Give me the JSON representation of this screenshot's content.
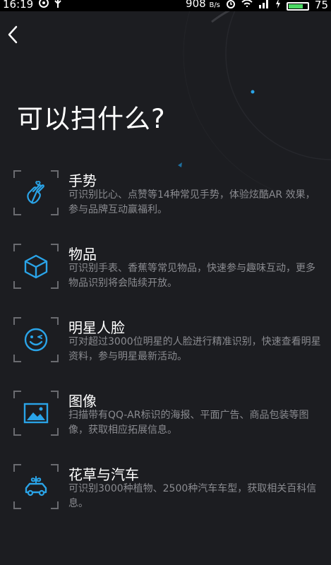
{
  "status_bar": {
    "time": "16:19",
    "network_speed": "908",
    "network_speed_unit": "B/s",
    "battery_level": "75"
  },
  "header": {
    "back_icon": "chevron-left-icon"
  },
  "page": {
    "title": "可以扫什么?"
  },
  "items": [
    {
      "icon": "hand-gesture-icon",
      "title": "手势",
      "description": "可识别比心、点赞等14种常见手势，体验炫酷AR 效果，参与品牌互动赢福利。"
    },
    {
      "icon": "cube-icon",
      "title": "物品",
      "description": "可识别手表、香蕉等常见物品，快速参与趣味互动，更多物品识别将会陆续开放。"
    },
    {
      "icon": "wink-face-icon",
      "title": "明星人脸",
      "description": "可对超过3000位明星的人脸进行精准识别，快速查看明星资料，参与明星最新活动。"
    },
    {
      "icon": "image-icon",
      "title": "图像",
      "description": "扫描带有QQ-AR标识的海报、平面广告、商品包装等图像，获取相应拓展信息。"
    },
    {
      "icon": "car-plant-icon",
      "title": "花草与汽车",
      "description": "可识别3000种植物、2500种汽车车型，获取相关百科信息。"
    }
  ],
  "colors": {
    "background": "#1c1d21",
    "accent": "#2aa4e8",
    "description_text": "#8a8b90",
    "frame_corner": "#6a6b70"
  }
}
